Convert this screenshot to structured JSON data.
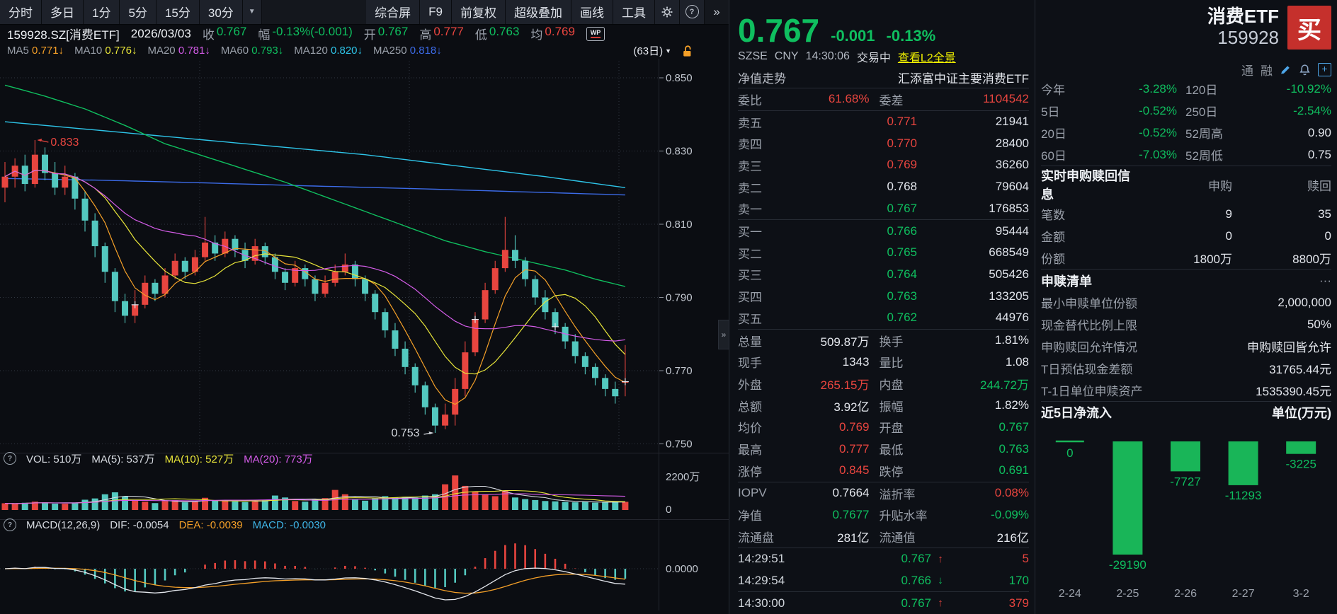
{
  "colors": {
    "green": "#0fbf5f",
    "red": "#e8453f",
    "candle_down": "#53c8bf",
    "link_yellow": "#f0f000",
    "buy_button": "#c5302c",
    "flow_bar": "#19b558",
    "ma5": "#f5a028",
    "ma10": "#e8e53a",
    "ma20": "#d45ce8",
    "ma60": "#0fbf5f",
    "ma120": "#2ec4e8",
    "ma250": "#3c6be8"
  },
  "toolbar": {
    "tabs": [
      "分时",
      "多日",
      "1分",
      "5分",
      "15分",
      "30分"
    ],
    "caret": "▼",
    "right": [
      "综合屏",
      "F9",
      "前复权",
      "超级叠加",
      "画线",
      "工具"
    ],
    "help": "?",
    "more": "»"
  },
  "infobar": {
    "symbol": "159928.SZ[消费ETF]",
    "date": "2026/03/03",
    "wp": "WP",
    "fields": [
      [
        "收",
        "0.767",
        "g"
      ],
      [
        "幅",
        "-0.13%(-0.001)",
        "g"
      ],
      [
        "开",
        "0.767",
        "g"
      ],
      [
        "高",
        "0.777",
        "r"
      ],
      [
        "低",
        "0.763",
        "g"
      ],
      [
        "均",
        "0.769",
        "r"
      ]
    ]
  },
  "ma_bar": {
    "arrow": "↓",
    "period": "(63日)",
    "caret": "▼",
    "items": [
      [
        "MA5",
        "0.771",
        "#f5a028"
      ],
      [
        "MA10",
        "0.776",
        "#e8e53a"
      ],
      [
        "MA20",
        "0.781",
        "#d45ce8"
      ],
      [
        "MA60",
        "0.793",
        "#0fbf5f"
      ],
      [
        "MA120",
        "0.820",
        "#2ec4e8"
      ],
      [
        "MA250",
        "0.818",
        "#3c6be8"
      ]
    ]
  },
  "vol_panel": {
    "help": "?",
    "items": [
      [
        "VOL: 510万",
        "#d8dce2"
      ],
      [
        "MA(5): 537万",
        "#d8dce2"
      ],
      [
        "MA(10): 527万",
        "#e8e53a"
      ],
      [
        "MA(20): 773万",
        "#d45ce8"
      ]
    ],
    "axis": [
      "2200万",
      "0"
    ]
  },
  "macd_panel": {
    "help": "?",
    "items": [
      [
        "MACD(12,26,9)",
        "#d8dce2"
      ],
      [
        "DIF: -0.0054",
        "#d8dce2"
      ],
      [
        "DEA: -0.0039",
        "#f5a028"
      ],
      [
        "MACD: -0.0030",
        "#3fb6e8"
      ]
    ],
    "axis": "0.0000"
  },
  "quote": {
    "price": "0.767",
    "change": "-0.001",
    "change_pct": "-0.13%",
    "exchange": "SZSE",
    "currency": "CNY",
    "time": "14:30:06",
    "status": "交易中",
    "l2_link": "查看L2全景",
    "nav_label": "净值走势",
    "fund_name": "汇添富中证主要消费ETF",
    "weibi_label": "委比",
    "weibi": "61.68%",
    "weicha_label": "委差",
    "weicha": "1104542",
    "asks": [
      [
        "卖五",
        "0.771",
        "21941",
        "r"
      ],
      [
        "卖四",
        "0.770",
        "28400",
        "r"
      ],
      [
        "卖三",
        "0.769",
        "36260",
        "r"
      ],
      [
        "卖二",
        "0.768",
        "79604",
        "w"
      ],
      [
        "卖一",
        "0.767",
        "176853",
        "g"
      ]
    ],
    "bids": [
      [
        "买一",
        "0.766",
        "95444",
        "g"
      ],
      [
        "买二",
        "0.765",
        "668549",
        "g"
      ],
      [
        "买三",
        "0.764",
        "505426",
        "g"
      ],
      [
        "买四",
        "0.763",
        "133205",
        "g"
      ],
      [
        "买五",
        "0.762",
        "44976",
        "g"
      ]
    ],
    "stats": [
      [
        "总量",
        "509.87万",
        "w",
        "换手",
        "1.81%",
        "w"
      ],
      [
        "现手",
        "1343",
        "w",
        "量比",
        "1.08",
        "w"
      ],
      [
        "外盘",
        "265.15万",
        "r",
        "内盘",
        "244.72万",
        "g"
      ],
      [
        "总额",
        "3.92亿",
        "w",
        "振幅",
        "1.82%",
        "w"
      ],
      [
        "均价",
        "0.769",
        "r",
        "开盘",
        "0.767",
        "g"
      ],
      [
        "最高",
        "0.777",
        "r",
        "最低",
        "0.763",
        "g"
      ],
      [
        "涨停",
        "0.845",
        "r",
        "跌停",
        "0.691",
        "g"
      ],
      [
        "IOPV",
        "0.7664",
        "w",
        "溢折率",
        "0.08%",
        "r"
      ],
      [
        "净值",
        "0.7677",
        "g",
        "升贴水率",
        "-0.09%",
        "g"
      ],
      [
        "流通盘",
        "281亿",
        "w",
        "流通值",
        "216亿",
        "w"
      ]
    ],
    "ticks": [
      [
        "14:29:51",
        "0.767",
        "up",
        "5"
      ],
      [
        "14:29:54",
        "0.766",
        "down",
        "170"
      ],
      [
        "14:30:00",
        "0.767",
        "up",
        "379"
      ]
    ]
  },
  "security": {
    "name": "消费ETF",
    "code": "159928",
    "buy_label": "买",
    "badges": [
      "通",
      "融"
    ]
  },
  "panel2": {
    "perf": [
      [
        "今年",
        "-3.28%",
        "g",
        "120日",
        "-10.92%",
        "g"
      ],
      [
        "5日",
        "-0.52%",
        "g",
        "250日",
        "-2.54%",
        "g"
      ],
      [
        "20日",
        "-0.52%",
        "g",
        "52周高",
        "0.90",
        "w"
      ],
      [
        "60日",
        "-7.03%",
        "g",
        "52周低",
        "0.75",
        "w"
      ]
    ],
    "subscription": {
      "title": "实时申购赎回信息",
      "col1": "申购",
      "col2": "赎回",
      "rows": [
        [
          "笔数",
          "9",
          "35"
        ],
        [
          "金额",
          "0",
          "0"
        ],
        [
          "份额",
          "1800万",
          "8800万"
        ]
      ]
    },
    "redeem_list": {
      "title": "申赎清单",
      "more": "···",
      "rows": [
        [
          "最小申赎单位份额",
          "2,000,000"
        ],
        [
          "现金替代比例上限",
          "50%"
        ],
        [
          "申购赎回允许情况",
          "申购赎回皆允许"
        ],
        [
          "T日预估现金差额",
          "31765.44元"
        ],
        [
          "T-1日单位申赎资产",
          "1535390.45元"
        ]
      ]
    },
    "net_inflow_title": "近5日净流入",
    "net_inflow_unit": "单位(万元)"
  },
  "chart_data": [
    {
      "type": "candlestick",
      "symbol": "159928.SZ 消费ETF",
      "period": "日K",
      "visible_days": 63,
      "y_ticks": [
        "0.850",
        "0.830",
        "0.810",
        "0.790",
        "0.770",
        "0.750"
      ],
      "ylim": [
        0.748,
        0.852
      ],
      "vol_axis_max_label": "2200万",
      "vol_max": 2200,
      "annotations": {
        "high": {
          "index": 3,
          "price": 0.833,
          "label": "0.833"
        },
        "low": {
          "index": 43,
          "price": 0.753,
          "label": "0.753"
        }
      },
      "cross_marks": [
        13,
        47,
        55,
        62
      ],
      "candles": [
        [
          0.82,
          0.827,
          0.816,
          0.823
        ],
        [
          0.823,
          0.828,
          0.82,
          0.826
        ],
        [
          0.826,
          0.829,
          0.819,
          0.821
        ],
        [
          0.821,
          0.833,
          0.82,
          0.829
        ],
        [
          0.829,
          0.831,
          0.822,
          0.824
        ],
        [
          0.824,
          0.827,
          0.818,
          0.82
        ],
        [
          0.82,
          0.826,
          0.818,
          0.823
        ],
        [
          0.823,
          0.824,
          0.814,
          0.817
        ],
        [
          0.817,
          0.819,
          0.808,
          0.811
        ],
        [
          0.811,
          0.813,
          0.801,
          0.804
        ],
        [
          0.804,
          0.805,
          0.794,
          0.797
        ],
        [
          0.797,
          0.798,
          0.786,
          0.789
        ],
        [
          0.789,
          0.791,
          0.783,
          0.785
        ],
        [
          0.785,
          0.792,
          0.783,
          0.788
        ],
        [
          0.788,
          0.796,
          0.787,
          0.794
        ],
        [
          0.794,
          0.795,
          0.789,
          0.791
        ],
        [
          0.791,
          0.798,
          0.79,
          0.796
        ],
        [
          0.796,
          0.802,
          0.795,
          0.8
        ],
        [
          0.8,
          0.801,
          0.795,
          0.797
        ],
        [
          0.797,
          0.803,
          0.796,
          0.801
        ],
        [
          0.801,
          0.812,
          0.8,
          0.805
        ],
        [
          0.805,
          0.807,
          0.8,
          0.802
        ],
        [
          0.802,
          0.808,
          0.801,
          0.806
        ],
        [
          0.806,
          0.807,
          0.801,
          0.803
        ],
        [
          0.803,
          0.805,
          0.798,
          0.8
        ],
        [
          0.8,
          0.806,
          0.799,
          0.804
        ],
        [
          0.804,
          0.805,
          0.799,
          0.801
        ],
        [
          0.801,
          0.802,
          0.795,
          0.797
        ],
        [
          0.797,
          0.798,
          0.792,
          0.794
        ],
        [
          0.794,
          0.8,
          0.793,
          0.798
        ],
        [
          0.798,
          0.799,
          0.793,
          0.795
        ],
        [
          0.795,
          0.796,
          0.789,
          0.791
        ],
        [
          0.791,
          0.796,
          0.79,
          0.794
        ],
        [
          0.794,
          0.799,
          0.793,
          0.797
        ],
        [
          0.797,
          0.802,
          0.796,
          0.799
        ],
        [
          0.799,
          0.8,
          0.793,
          0.795
        ],
        [
          0.795,
          0.796,
          0.789,
          0.791
        ],
        [
          0.791,
          0.792,
          0.784,
          0.786
        ],
        [
          0.786,
          0.787,
          0.779,
          0.781
        ],
        [
          0.781,
          0.783,
          0.774,
          0.776
        ],
        [
          0.776,
          0.778,
          0.769,
          0.771
        ],
        [
          0.771,
          0.772,
          0.764,
          0.766
        ],
        [
          0.766,
          0.767,
          0.758,
          0.76
        ],
        [
          0.76,
          0.761,
          0.753,
          0.755
        ],
        [
          0.755,
          0.761,
          0.754,
          0.758
        ],
        [
          0.758,
          0.768,
          0.755,
          0.765
        ],
        [
          0.765,
          0.778,
          0.763,
          0.775
        ],
        [
          0.775,
          0.786,
          0.774,
          0.784
        ],
        [
          0.784,
          0.794,
          0.783,
          0.792
        ],
        [
          0.792,
          0.8,
          0.791,
          0.798
        ],
        [
          0.798,
          0.812,
          0.797,
          0.803
        ],
        [
          0.803,
          0.807,
          0.798,
          0.8
        ],
        [
          0.8,
          0.801,
          0.793,
          0.795
        ],
        [
          0.795,
          0.796,
          0.788,
          0.79
        ],
        [
          0.79,
          0.792,
          0.784,
          0.786
        ],
        [
          0.786,
          0.787,
          0.78,
          0.782
        ],
        [
          0.782,
          0.783,
          0.776,
          0.778
        ],
        [
          0.778,
          0.78,
          0.772,
          0.774
        ],
        [
          0.774,
          0.775,
          0.769,
          0.771
        ],
        [
          0.771,
          0.772,
          0.766,
          0.768
        ],
        [
          0.768,
          0.769,
          0.763,
          0.765
        ],
        [
          0.765,
          0.767,
          0.761,
          0.763
        ],
        [
          0.767,
          0.777,
          0.763,
          0.767
        ]
      ],
      "volumes": [
        420,
        380,
        450,
        520,
        480,
        400,
        390,
        460,
        640,
        720,
        980,
        1100,
        850,
        600,
        520,
        430,
        560,
        610,
        480,
        520,
        760,
        580,
        620,
        540,
        500,
        530,
        620,
        900,
        780,
        560,
        520,
        680,
        740,
        1250,
        980,
        640,
        580,
        720,
        860,
        780,
        820,
        760,
        900,
        980,
        1600,
        2150,
        1500,
        1150,
        980,
        860,
        1200,
        780,
        680,
        620,
        560,
        540,
        500,
        480,
        520,
        460,
        480,
        520,
        510
      ],
      "ma_curves": {
        "ma60": [
          [
            0,
            0.848
          ],
          [
            4,
            0.845
          ],
          [
            8,
            0.8415
          ],
          [
            12,
            0.837
          ],
          [
            16,
            0.832
          ],
          [
            20,
            0.8285
          ],
          [
            24,
            0.825
          ],
          [
            28,
            0.8215
          ],
          [
            32,
            0.8175
          ],
          [
            36,
            0.8135
          ],
          [
            40,
            0.8095
          ],
          [
            44,
            0.8055
          ],
          [
            48,
            0.8025
          ],
          [
            52,
            0.8
          ],
          [
            56,
            0.7975
          ],
          [
            59,
            0.795
          ],
          [
            62,
            0.793
          ]
        ],
        "ma120": [
          [
            0,
            0.838
          ],
          [
            6,
            0.8365
          ],
          [
            12,
            0.835
          ],
          [
            18,
            0.8335
          ],
          [
            24,
            0.832
          ],
          [
            30,
            0.8305
          ],
          [
            36,
            0.829
          ],
          [
            42,
            0.827
          ],
          [
            48,
            0.825
          ],
          [
            54,
            0.823
          ],
          [
            58,
            0.8215
          ],
          [
            62,
            0.82
          ]
        ],
        "ma250": [
          [
            0,
            0.8225
          ],
          [
            10,
            0.822
          ],
          [
            20,
            0.8213
          ],
          [
            30,
            0.8205
          ],
          [
            40,
            0.8198
          ],
          [
            50,
            0.819
          ],
          [
            62,
            0.818
          ]
        ]
      }
    },
    {
      "type": "bar",
      "title": "近5日净流入",
      "unit": "单位(万元)",
      "categories": [
        "2-24",
        "2-25",
        "2-26",
        "2-27",
        "3-2"
      ],
      "values": [
        0,
        -29190,
        -7727,
        -11293,
        -3225
      ],
      "bar_color": "#19b558"
    }
  ]
}
